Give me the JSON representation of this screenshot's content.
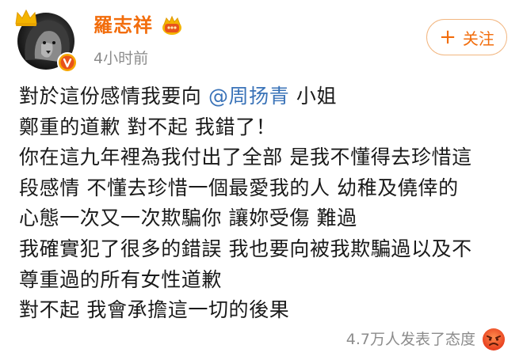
{
  "user": {
    "name": "羅志祥",
    "time": "4小时前"
  },
  "follow": {
    "plus": "+",
    "label": "关注"
  },
  "post": {
    "line1_prefix": "對於這份感情我要向 ",
    "mention": "@周扬青",
    "line1_suffix": " 小姐",
    "line2": "鄭重的道歉 對不起 我錯了！",
    "line3": "你在這九年裡為我付出了全部 是我不懂得去珍惜這",
    "line4": "段感情 不懂去珍惜一個最愛我的人 幼稚及僥倖的",
    "line5": "心態一次又一次欺騙你 讓妳受傷 難過",
    "line6": "我確實犯了很多的錯誤 我也要向被我欺騙過以及不",
    "line7": "尊重過的所有女性道歉",
    "line8": "對不起  我會承擔這一切的後果"
  },
  "footer": {
    "reactions": "4.7万人发表了态度",
    "reaction_icon": "angry-face-icon"
  },
  "colors": {
    "username": "#f26d0c",
    "link": "#3a73b8",
    "muted": "#8c8c8c",
    "follow_border": "#f2b680"
  }
}
